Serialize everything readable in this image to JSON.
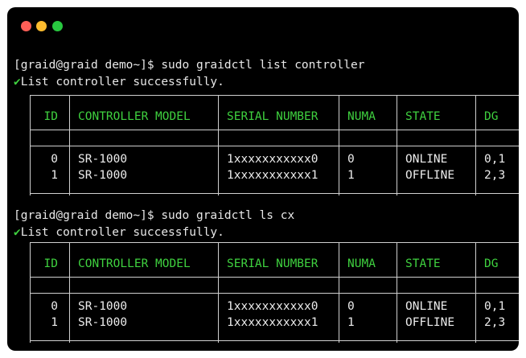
{
  "window": {
    "colors": {
      "background": "#000000",
      "header_text": "#3fd13f",
      "text": "#e8e8e8"
    }
  },
  "session": [
    {
      "prompt": "[graid@graid demo~]$ sudo graidctl list controller",
      "status_symbol": "✔",
      "status_text": "List controller successfully.",
      "table": {
        "columns": [
          "ID",
          "CONTROLLER MODEL",
          "SERIAL NUMBER",
          "NUMA",
          "STATE",
          "DG"
        ],
        "rows": [
          [
            "0",
            "SR-1000",
            "1xxxxxxxxxxx0",
            "0",
            "ONLINE",
            "0,1"
          ],
          [
            "1",
            "SR-1000",
            "1xxxxxxxxxxx1",
            "1",
            "OFFLINE",
            "2,3"
          ]
        ]
      }
    },
    {
      "prompt": "[graid@graid demo~]$ sudo graidctl ls cx",
      "status_symbol": "✔",
      "status_text": "List controller successfully.",
      "table": {
        "columns": [
          "ID",
          "CONTROLLER MODEL",
          "SERIAL NUMBER",
          "NUMA",
          "STATE",
          "DG"
        ],
        "rows": [
          [
            "0",
            "SR-1000",
            "1xxxxxxxxxxx0",
            "0",
            "ONLINE",
            "0,1"
          ],
          [
            "1",
            "SR-1000",
            "1xxxxxxxxxxx1",
            "1",
            "OFFLINE",
            "2,3"
          ]
        ]
      }
    }
  ]
}
